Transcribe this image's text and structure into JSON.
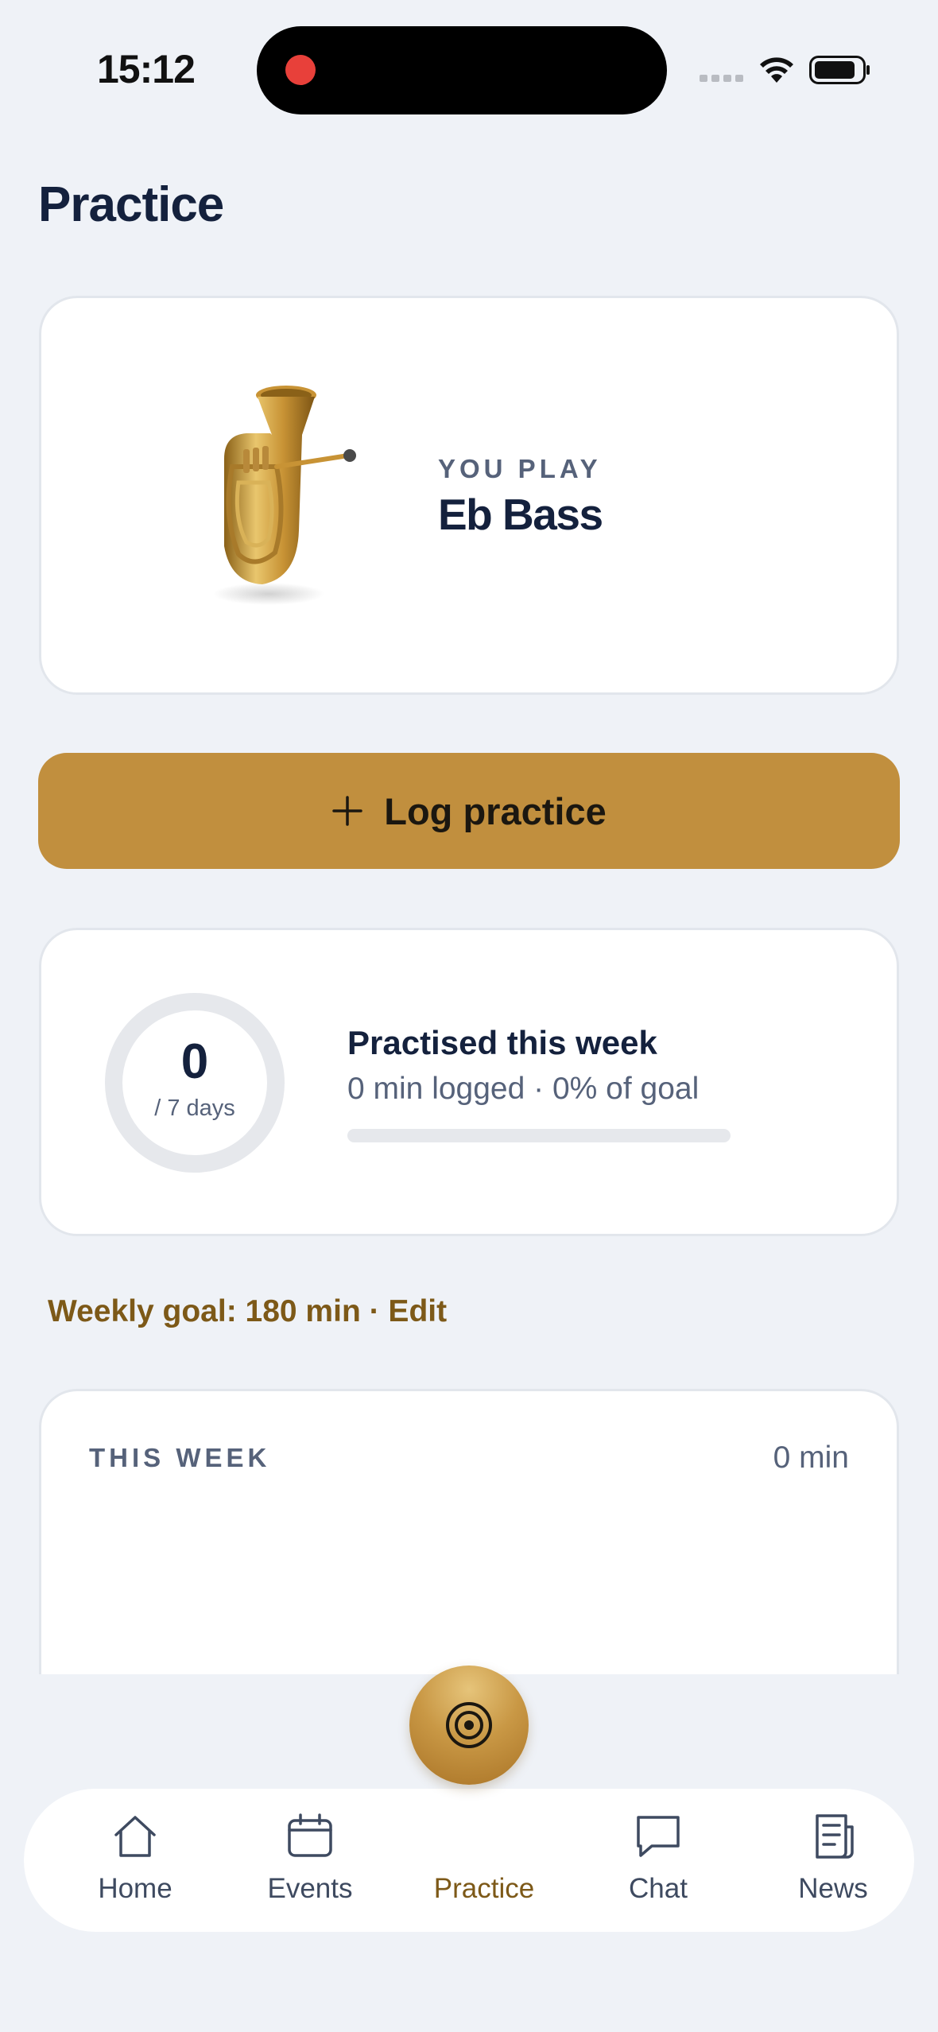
{
  "status_bar": {
    "time": "15:12",
    "icons": [
      "recording-dot-icon",
      "signal-icon",
      "wifi-icon",
      "battery-icon"
    ]
  },
  "page": {
    "title": "Practice"
  },
  "instrument_card": {
    "label": "YOU PLAY",
    "instrument": "Eb Bass",
    "image": "tuba-icon"
  },
  "log_button": {
    "label": "Log practice",
    "icon": "plus-icon"
  },
  "week_summary": {
    "days_count": "0",
    "days_suffix": "/ 7 days",
    "title": "Practised this week",
    "subtitle": "0 min logged · 0% of goal",
    "progress_fraction": 0
  },
  "weekly_goal": {
    "text": "Weekly goal: 180 min · Edit"
  },
  "this_week": {
    "label": "THIS WEEK",
    "total": "0 min"
  },
  "nav": {
    "items": [
      {
        "label": "Home",
        "icon": "home-icon"
      },
      {
        "label": "Events",
        "icon": "calendar-icon"
      },
      {
        "label": "Practice",
        "icon": "target-icon",
        "active": true
      },
      {
        "label": "Chat",
        "icon": "chat-icon"
      },
      {
        "label": "News",
        "icon": "news-icon"
      }
    ]
  },
  "colors": {
    "background": "#eff2f7",
    "accent": "#c18f3e",
    "accent_text": "#7d5918",
    "primary_text": "#14213d",
    "secondary_text": "#56627a"
  }
}
